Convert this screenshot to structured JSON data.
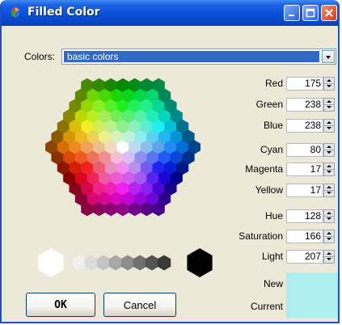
{
  "window": {
    "title": "Filled Color",
    "icon": "palette-icon",
    "controls": [
      "minimize-icon",
      "maximize-icon",
      "close-icon"
    ]
  },
  "colors_selector": {
    "label": "Colors:",
    "selected": "basic colors"
  },
  "rgb": [
    {
      "label": "Red",
      "value": "175"
    },
    {
      "label": "Green",
      "value": "238"
    },
    {
      "label": "Blue",
      "value": "238"
    }
  ],
  "cmy": [
    {
      "label": "Cyan",
      "value": "80"
    },
    {
      "label": "Magenta",
      "value": "17"
    },
    {
      "label": "Yellow",
      "value": "17"
    }
  ],
  "hsl": [
    {
      "label": "Hue",
      "value": "128"
    },
    {
      "label": "Saturation",
      "value": "166"
    },
    {
      "label": "Light",
      "value": "207"
    }
  ],
  "preview": {
    "new_label": "New",
    "current_label": "Current",
    "new_color": "#afeeee",
    "current_color": "#afeeee"
  },
  "buttons": {
    "ok": "OK",
    "cancel": "Cancel"
  }
}
